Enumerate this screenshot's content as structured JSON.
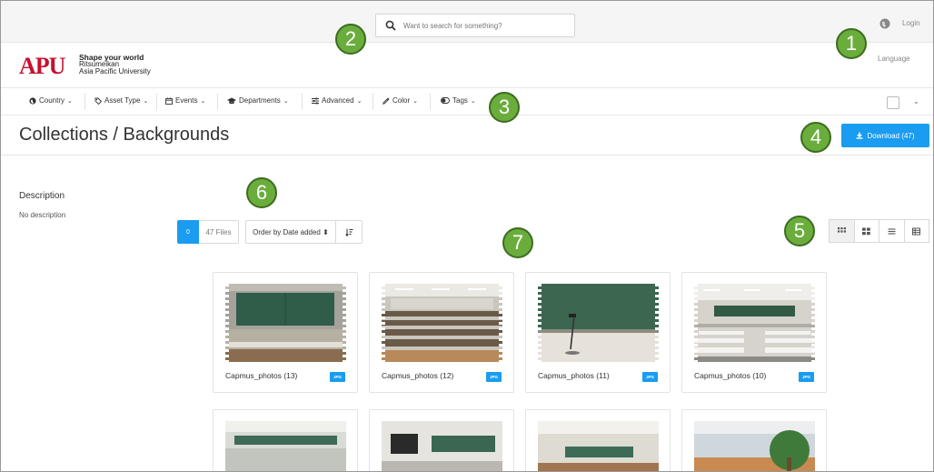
{
  "topbar": {
    "search_placeholder": "Want to search for something?",
    "login_label": "Login",
    "language_label": "Language"
  },
  "brand": {
    "logo_text": "APU",
    "tagline_1": "Shape your world",
    "tagline_2": "Ritsumeikan",
    "tagline_3": "Asia Pacific University"
  },
  "filters": [
    {
      "label": "Country",
      "icon": "globe-icon"
    },
    {
      "label": "Asset Type",
      "icon": "tag-icon"
    },
    {
      "label": "Events",
      "icon": "calendar-icon"
    },
    {
      "label": "Departments",
      "icon": "graduation-cap-icon"
    },
    {
      "label": "Advanced",
      "icon": "sliders-icon"
    },
    {
      "label": "Color",
      "icon": "eyedropper-icon"
    },
    {
      "label": "Tags",
      "icon": "toggle-icon"
    }
  ],
  "page": {
    "title": "Collections / Backgrounds",
    "download_label": "Download (47)"
  },
  "description": {
    "heading": "Description",
    "text": "No description"
  },
  "toolbar": {
    "selected_count": "0",
    "files_count": "47 Files",
    "order_label": "Order by Date added ⬍"
  },
  "files": [
    {
      "name": "Capmus_photos (13)",
      "type": "JPG"
    },
    {
      "name": "Capmus_photos (12)",
      "type": "JPG"
    },
    {
      "name": "Capmus_photos (11)",
      "type": "JPG"
    },
    {
      "name": "Capmus_photos (10)",
      "type": "JPG"
    }
  ],
  "callouts": [
    "1",
    "2",
    "3",
    "4",
    "5",
    "6",
    "7"
  ],
  "colors": {
    "accent": "#1a9cf0",
    "logo_red": "#c8102e",
    "callout_green": "#6aad3c"
  }
}
